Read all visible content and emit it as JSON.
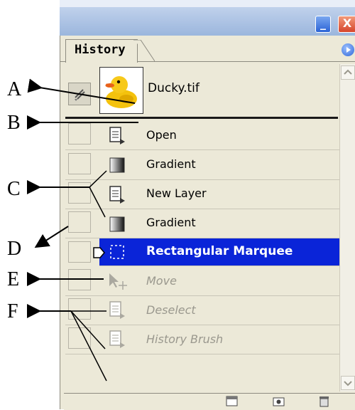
{
  "window": {
    "minimize_glyph": "_",
    "close_glyph": "X"
  },
  "panel": {
    "tab_label": "History"
  },
  "snapshot": {
    "label": "Ducky.tif"
  },
  "history_states": [
    {
      "label": "Open",
      "icon": "document-icon",
      "dimmed": false,
      "selected": false
    },
    {
      "label": "Gradient",
      "icon": "gradient-icon",
      "dimmed": false,
      "selected": false
    },
    {
      "label": "New Layer",
      "icon": "document-icon",
      "dimmed": false,
      "selected": false
    },
    {
      "label": "Gradient",
      "icon": "gradient-icon",
      "dimmed": false,
      "selected": false
    },
    {
      "label": "Rectangular Marquee",
      "icon": "marquee-icon",
      "dimmed": false,
      "selected": true
    },
    {
      "label": "Move",
      "icon": "move-tool-icon",
      "dimmed": true,
      "selected": false
    },
    {
      "label": "Deselect",
      "icon": "document-icon",
      "dimmed": true,
      "selected": false
    },
    {
      "label": "History Brush",
      "icon": "document-icon",
      "dimmed": true,
      "selected": false
    }
  ],
  "annotations": [
    "A",
    "B",
    "C",
    "D",
    "E",
    "F"
  ],
  "colors": {
    "selection_bg": "#0a24d8",
    "selection_text": "#ffffff",
    "dimmed_text": "#9a988e",
    "panel_bg": "#ece9d8"
  }
}
